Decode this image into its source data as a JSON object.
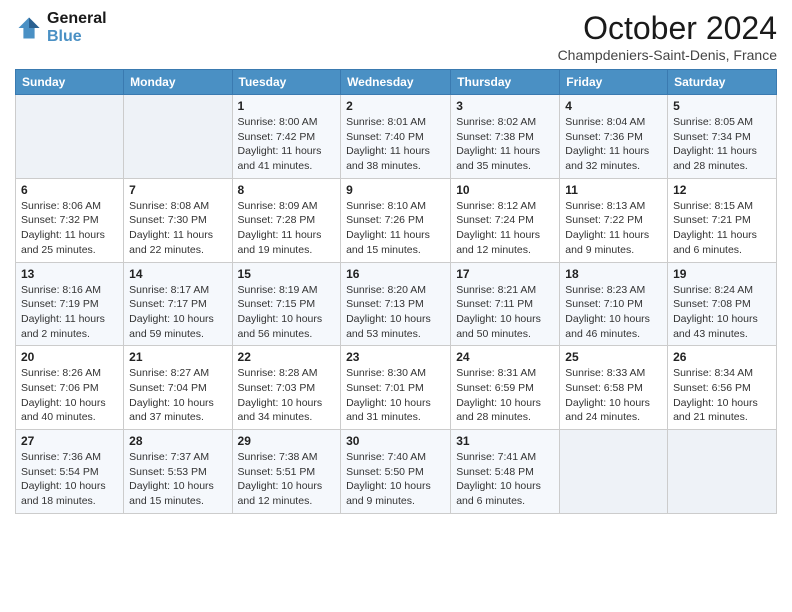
{
  "header": {
    "logo_line1": "General",
    "logo_line2": "Blue",
    "month": "October 2024",
    "location": "Champdeniers-Saint-Denis, France"
  },
  "weekdays": [
    "Sunday",
    "Monday",
    "Tuesday",
    "Wednesday",
    "Thursday",
    "Friday",
    "Saturday"
  ],
  "weeks": [
    [
      {
        "day": "",
        "sunrise": "",
        "sunset": "",
        "daylight": ""
      },
      {
        "day": "",
        "sunrise": "",
        "sunset": "",
        "daylight": ""
      },
      {
        "day": "1",
        "sunrise": "Sunrise: 8:00 AM",
        "sunset": "Sunset: 7:42 PM",
        "daylight": "Daylight: 11 hours and 41 minutes."
      },
      {
        "day": "2",
        "sunrise": "Sunrise: 8:01 AM",
        "sunset": "Sunset: 7:40 PM",
        "daylight": "Daylight: 11 hours and 38 minutes."
      },
      {
        "day": "3",
        "sunrise": "Sunrise: 8:02 AM",
        "sunset": "Sunset: 7:38 PM",
        "daylight": "Daylight: 11 hours and 35 minutes."
      },
      {
        "day": "4",
        "sunrise": "Sunrise: 8:04 AM",
        "sunset": "Sunset: 7:36 PM",
        "daylight": "Daylight: 11 hours and 32 minutes."
      },
      {
        "day": "5",
        "sunrise": "Sunrise: 8:05 AM",
        "sunset": "Sunset: 7:34 PM",
        "daylight": "Daylight: 11 hours and 28 minutes."
      }
    ],
    [
      {
        "day": "6",
        "sunrise": "Sunrise: 8:06 AM",
        "sunset": "Sunset: 7:32 PM",
        "daylight": "Daylight: 11 hours and 25 minutes."
      },
      {
        "day": "7",
        "sunrise": "Sunrise: 8:08 AM",
        "sunset": "Sunset: 7:30 PM",
        "daylight": "Daylight: 11 hours and 22 minutes."
      },
      {
        "day": "8",
        "sunrise": "Sunrise: 8:09 AM",
        "sunset": "Sunset: 7:28 PM",
        "daylight": "Daylight: 11 hours and 19 minutes."
      },
      {
        "day": "9",
        "sunrise": "Sunrise: 8:10 AM",
        "sunset": "Sunset: 7:26 PM",
        "daylight": "Daylight: 11 hours and 15 minutes."
      },
      {
        "day": "10",
        "sunrise": "Sunrise: 8:12 AM",
        "sunset": "Sunset: 7:24 PM",
        "daylight": "Daylight: 11 hours and 12 minutes."
      },
      {
        "day": "11",
        "sunrise": "Sunrise: 8:13 AM",
        "sunset": "Sunset: 7:22 PM",
        "daylight": "Daylight: 11 hours and 9 minutes."
      },
      {
        "day": "12",
        "sunrise": "Sunrise: 8:15 AM",
        "sunset": "Sunset: 7:21 PM",
        "daylight": "Daylight: 11 hours and 6 minutes."
      }
    ],
    [
      {
        "day": "13",
        "sunrise": "Sunrise: 8:16 AM",
        "sunset": "Sunset: 7:19 PM",
        "daylight": "Daylight: 11 hours and 2 minutes."
      },
      {
        "day": "14",
        "sunrise": "Sunrise: 8:17 AM",
        "sunset": "Sunset: 7:17 PM",
        "daylight": "Daylight: 10 hours and 59 minutes."
      },
      {
        "day": "15",
        "sunrise": "Sunrise: 8:19 AM",
        "sunset": "Sunset: 7:15 PM",
        "daylight": "Daylight: 10 hours and 56 minutes."
      },
      {
        "day": "16",
        "sunrise": "Sunrise: 8:20 AM",
        "sunset": "Sunset: 7:13 PM",
        "daylight": "Daylight: 10 hours and 53 minutes."
      },
      {
        "day": "17",
        "sunrise": "Sunrise: 8:21 AM",
        "sunset": "Sunset: 7:11 PM",
        "daylight": "Daylight: 10 hours and 50 minutes."
      },
      {
        "day": "18",
        "sunrise": "Sunrise: 8:23 AM",
        "sunset": "Sunset: 7:10 PM",
        "daylight": "Daylight: 10 hours and 46 minutes."
      },
      {
        "day": "19",
        "sunrise": "Sunrise: 8:24 AM",
        "sunset": "Sunset: 7:08 PM",
        "daylight": "Daylight: 10 hours and 43 minutes."
      }
    ],
    [
      {
        "day": "20",
        "sunrise": "Sunrise: 8:26 AM",
        "sunset": "Sunset: 7:06 PM",
        "daylight": "Daylight: 10 hours and 40 minutes."
      },
      {
        "day": "21",
        "sunrise": "Sunrise: 8:27 AM",
        "sunset": "Sunset: 7:04 PM",
        "daylight": "Daylight: 10 hours and 37 minutes."
      },
      {
        "day": "22",
        "sunrise": "Sunrise: 8:28 AM",
        "sunset": "Sunset: 7:03 PM",
        "daylight": "Daylight: 10 hours and 34 minutes."
      },
      {
        "day": "23",
        "sunrise": "Sunrise: 8:30 AM",
        "sunset": "Sunset: 7:01 PM",
        "daylight": "Daylight: 10 hours and 31 minutes."
      },
      {
        "day": "24",
        "sunrise": "Sunrise: 8:31 AM",
        "sunset": "Sunset: 6:59 PM",
        "daylight": "Daylight: 10 hours and 28 minutes."
      },
      {
        "day": "25",
        "sunrise": "Sunrise: 8:33 AM",
        "sunset": "Sunset: 6:58 PM",
        "daylight": "Daylight: 10 hours and 24 minutes."
      },
      {
        "day": "26",
        "sunrise": "Sunrise: 8:34 AM",
        "sunset": "Sunset: 6:56 PM",
        "daylight": "Daylight: 10 hours and 21 minutes."
      }
    ],
    [
      {
        "day": "27",
        "sunrise": "Sunrise: 7:36 AM",
        "sunset": "Sunset: 5:54 PM",
        "daylight": "Daylight: 10 hours and 18 minutes."
      },
      {
        "day": "28",
        "sunrise": "Sunrise: 7:37 AM",
        "sunset": "Sunset: 5:53 PM",
        "daylight": "Daylight: 10 hours and 15 minutes."
      },
      {
        "day": "29",
        "sunrise": "Sunrise: 7:38 AM",
        "sunset": "Sunset: 5:51 PM",
        "daylight": "Daylight: 10 hours and 12 minutes."
      },
      {
        "day": "30",
        "sunrise": "Sunrise: 7:40 AM",
        "sunset": "Sunset: 5:50 PM",
        "daylight": "Daylight: 10 hours and 9 minutes."
      },
      {
        "day": "31",
        "sunrise": "Sunrise: 7:41 AM",
        "sunset": "Sunset: 5:48 PM",
        "daylight": "Daylight: 10 hours and 6 minutes."
      },
      {
        "day": "",
        "sunrise": "",
        "sunset": "",
        "daylight": ""
      },
      {
        "day": "",
        "sunrise": "",
        "sunset": "",
        "daylight": ""
      }
    ]
  ]
}
